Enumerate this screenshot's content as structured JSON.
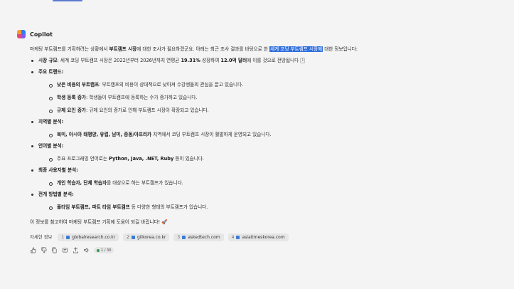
{
  "assistant": {
    "name": "Copilot"
  },
  "message": {
    "intro_before": "마케팅 부트캠프를 기획하려는 상황에서 ",
    "intro_bold": "부트캠프 시장",
    "intro_mid": "에 대한 조사가 필요하겠군요. 아래는 최근 조사 결과를 바탕으로 한 ",
    "intro_highlight": "세계 코딩 부트캠프 시장에",
    "intro_after": " 대한 정보입니다:",
    "sections": [
      {
        "bullet_title": "시장 규모",
        "bullet_text_pre": ": 세계 코딩 부트캠프 시장은 2022년부터 2026년까지 연평균 ",
        "bullet_bold_1": "19.31%",
        "bullet_text_mid": " 성장하여 ",
        "bullet_bold_2": "12.0억 달러",
        "bullet_text_post": "에 이를 것으로 전망됩니다",
        "citation": "1"
      },
      {
        "title": "주요 트렌드",
        "items": [
          {
            "bold": "낮은 비용의 부트캠프",
            "text": ": 부트캠프의 비용이 상대적으로 낮아져 수강생들의 관심을 끌고 있습니다."
          },
          {
            "bold": "학생 등록 증가",
            "text": ": 학생들이 부트캠프에 등록하는 수가 증가하고 있습니다."
          },
          {
            "bold": "규제 요인 증가",
            "text": ": 규제 요인의 증가로 인해 부트캠프 시장이 확장되고 있습니다."
          }
        ]
      },
      {
        "title": "지역별 분석",
        "items": [
          {
            "bold": "북미, 아시아 태평양, 유럽, 남미, 중동/아프리카",
            "text": " 지역에서 코딩 부트캠프 시장이 활발하게 운영되고 있습니다."
          }
        ]
      },
      {
        "title": "언어별 분석",
        "items": [
          {
            "text_pre": "주요 프로그래밍 언어로는 ",
            "bold": "Python, Java, .NET, Ruby",
            "text": " 등이 있습니다."
          }
        ]
      },
      {
        "title": "최종 사용자별 분석",
        "items": [
          {
            "bold": "개인 학습자, 단체 학습자",
            "text": "를 대상으로 하는 부트캠프가 있습니다."
          }
        ]
      },
      {
        "title": "전개 방법별 분석",
        "items": [
          {
            "bold": "풀타임 부트캠프, 파트 타임 부트캠프",
            "text": " 등 다양한 형태의 부트캠프가 있습니다."
          }
        ]
      }
    ],
    "closing": "이 정보를 참고하여 마케팅 부트캠프 기획에 도움이 되길 바랍니다! 🚀"
  },
  "sources": {
    "label": "자세한 정보",
    "items": [
      {
        "num": "1",
        "site": "globalresearch.co.kr"
      },
      {
        "num": "2",
        "site": "giikorea.co.kr"
      },
      {
        "num": "3",
        "site": "askedtech.com"
      },
      {
        "num": "4",
        "site": "asiatimeskorea.com"
      }
    ]
  },
  "actions": {
    "icons": [
      "thumbs-up-icon",
      "thumbs-down-icon",
      "copy-icon",
      "share-icon",
      "export-icon",
      "speaker-icon"
    ],
    "pager": "1 / 30"
  },
  "colors": {
    "highlight": "#2f6fdf",
    "background": "#f4f4f4"
  }
}
